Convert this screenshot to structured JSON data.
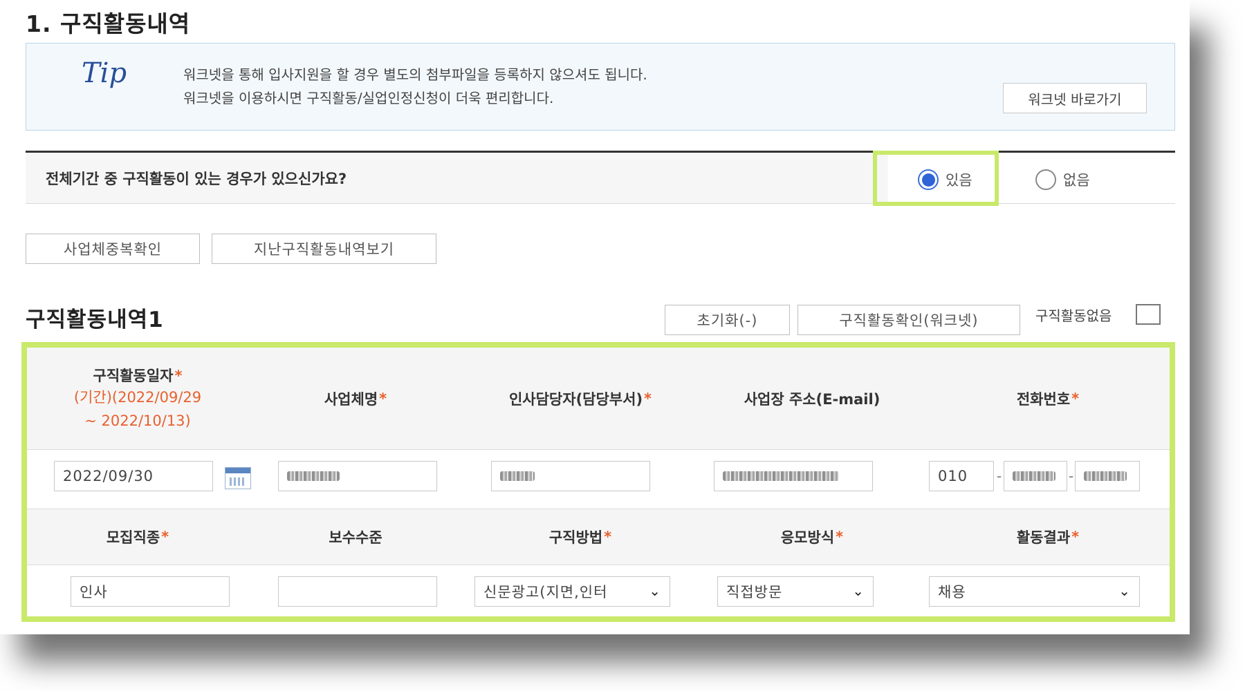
{
  "section": {
    "title": "1. 구직활동내역"
  },
  "tip": {
    "logo": "Tip",
    "line1": "워크넷을 통해 입사지원을 할 경우 별도의 첨부파일을 등록하지 않으셔도 됩니다.",
    "line2": "워크넷을 이용하시면 구직활동/실업인정신청이 더욱 편리합니다.",
    "button": "워크넷 바로가기"
  },
  "question": {
    "text": "전체기간 중 구직활동이 있는 경우가 있으신가요?",
    "options": [
      {
        "label": "있음",
        "selected": true
      },
      {
        "label": "없음",
        "selected": false
      }
    ]
  },
  "actions": {
    "check_duplicate": "사업체중복확인",
    "view_past": "지난구직활동내역보기"
  },
  "activity": {
    "title": "구직활동내역1",
    "reset_button": "초기화(-)",
    "worknet_button": "구직활동확인(워크넷)",
    "no_activity_label": "구직활동없음",
    "headers1": {
      "date": "구직활동일자",
      "period1": "(기간)(2022/09/29",
      "period2": "~ 2022/10/13)",
      "company": "사업체명",
      "manager": "인사담당자(담당부서)",
      "address": "사업장 주소(E-mail)",
      "phone": "전화번호"
    },
    "values1": {
      "date": "2022/09/30",
      "phone_prefix": "010"
    },
    "headers2": {
      "job_type": "모집직종",
      "salary": "보수수준",
      "method": "구직방법",
      "apply": "응모방식",
      "result": "활동결과"
    },
    "values2": {
      "job_type": "인사",
      "salary": "",
      "method": "신문광고(지면,인터",
      "apply": "직접방문",
      "result": "채용"
    },
    "required_mark": "*"
  },
  "colors": {
    "highlight": "#c9e96a",
    "required": "#e8602e",
    "radio": "#2e64d6"
  }
}
